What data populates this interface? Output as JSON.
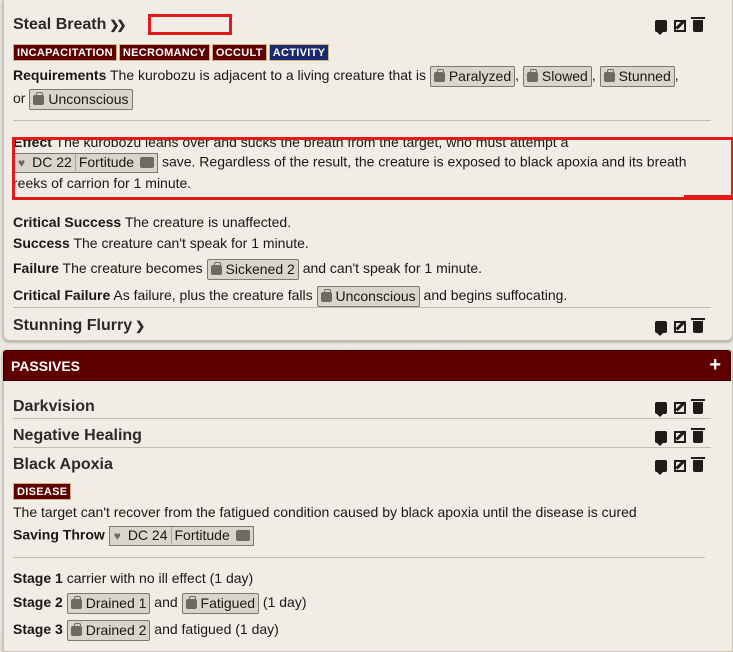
{
  "top": {
    "steal_breath": {
      "title": "Steal Breath",
      "action_glyph": "❯❯",
      "tags": [
        "INCAPACITATION",
        "NECROMANCY",
        "OCCULT",
        "ACTIVITY"
      ],
      "requirements_label": "Requirements",
      "requirements_text": "The kurobozu is adjacent to a living creature that is",
      "conditions": [
        "Paralyzed",
        "Slowed",
        "Stunned",
        "Unconscious"
      ],
      "or_text": "or",
      "effect_label": "Effect",
      "effect_line1": "The kurobozu leans over and sucks the breath from the target, who must attempt a",
      "dc_text": "DC 22",
      "dc_save": "Fortitude",
      "effect_line2_tail": "save. Regardless of the result, the creature is exposed to black apoxia and its breath",
      "effect_line3": "reeks of carrion for 1 minute.",
      "crit_success_label": "Critical Success",
      "crit_success_text": "The creature is unaffected.",
      "success_label": "Success",
      "success_text": "The creature can't speak for 1 minute.",
      "failure_label": "Failure",
      "failure_pre": "The creature becomes",
      "failure_chip": "Sickened 2",
      "failure_post": "and can't speak for 1 minute.",
      "crit_failure_label": "Critical Failure",
      "crit_failure_pre": "As failure, plus the creature falls",
      "crit_failure_chip": "Unconscious",
      "crit_failure_post": "and begins suffocating."
    },
    "stunning_flurry": {
      "title": "Stunning Flurry",
      "action_glyph": "❯"
    }
  },
  "passives": {
    "header": "PASSIVES",
    "plus": "+",
    "items": [
      "Darkvision",
      "Negative Healing",
      "Black Apoxia"
    ],
    "black_apoxia": {
      "tag": "DISEASE",
      "desc": "The target can't recover from the fatigued condition caused by black apoxia until the disease is cured",
      "saving_label": "Saving Throw",
      "dc_text": "DC 24",
      "dc_save": "Fortitude",
      "stage1_label": "Stage 1",
      "stage1_text": "carrier with no ill effect (1 day)",
      "stage2_label": "Stage 2",
      "stage2_chip1": "Drained 1",
      "stage2_and": "and",
      "stage2_chip2": "Fatigued",
      "stage2_tail": "(1 day)",
      "stage3_label": "Stage 3",
      "stage3_chip": "Drained 2",
      "stage3_tail": "and fatigued (1 day)"
    }
  },
  "colors": {
    "maroon": "#5e0000",
    "navy": "#1a2a6e",
    "annotation_red": "#e41919"
  }
}
